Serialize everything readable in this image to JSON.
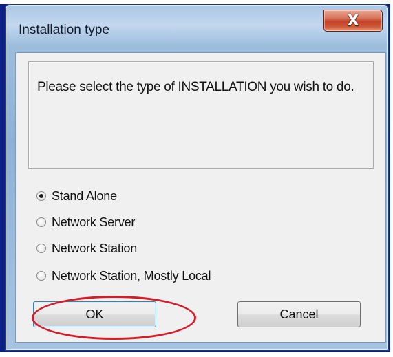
{
  "dialog": {
    "title": "Installation type",
    "close_symbol": "X",
    "message": "Please select the type of INSTALLATION you wish to do.",
    "options": [
      {
        "label": "Stand Alone",
        "selected": true
      },
      {
        "label": "Network Server",
        "selected": false
      },
      {
        "label": "Network Station",
        "selected": false
      },
      {
        "label": "Network Station, Mostly Local",
        "selected": false
      }
    ],
    "ok_label": "OK",
    "cancel_label": "Cancel"
  },
  "annotation": {
    "color": "#d51d2a",
    "target": "ok-button"
  },
  "icons": {
    "close": "close-icon",
    "radio": "radio-icon"
  }
}
